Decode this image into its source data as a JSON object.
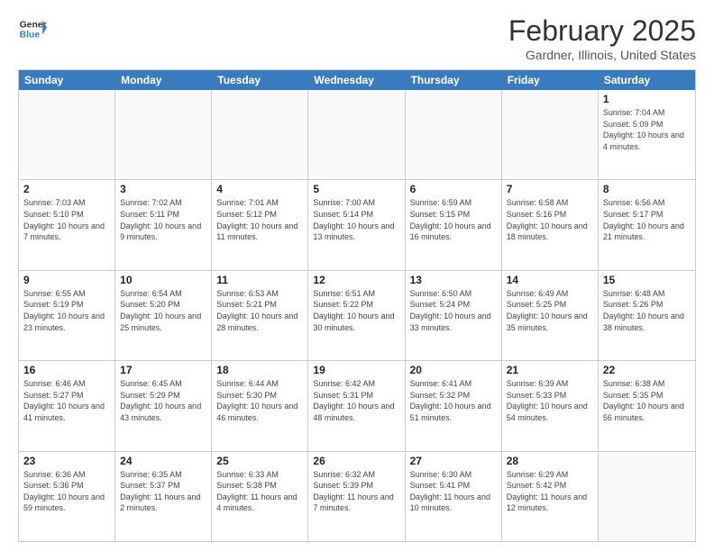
{
  "logo": {
    "line1": "General",
    "line2": "Blue"
  },
  "title": "February 2025",
  "subtitle": "Gardner, Illinois, United States",
  "days_of_week": [
    "Sunday",
    "Monday",
    "Tuesday",
    "Wednesday",
    "Thursday",
    "Friday",
    "Saturday"
  ],
  "weeks": [
    [
      {
        "day": "",
        "info": ""
      },
      {
        "day": "",
        "info": ""
      },
      {
        "day": "",
        "info": ""
      },
      {
        "day": "",
        "info": ""
      },
      {
        "day": "",
        "info": ""
      },
      {
        "day": "",
        "info": ""
      },
      {
        "day": "1",
        "info": "Sunrise: 7:04 AM\nSunset: 5:09 PM\nDaylight: 10 hours and 4 minutes."
      }
    ],
    [
      {
        "day": "2",
        "info": "Sunrise: 7:03 AM\nSunset: 5:10 PM\nDaylight: 10 hours and 7 minutes."
      },
      {
        "day": "3",
        "info": "Sunrise: 7:02 AM\nSunset: 5:11 PM\nDaylight: 10 hours and 9 minutes."
      },
      {
        "day": "4",
        "info": "Sunrise: 7:01 AM\nSunset: 5:12 PM\nDaylight: 10 hours and 11 minutes."
      },
      {
        "day": "5",
        "info": "Sunrise: 7:00 AM\nSunset: 5:14 PM\nDaylight: 10 hours and 13 minutes."
      },
      {
        "day": "6",
        "info": "Sunrise: 6:59 AM\nSunset: 5:15 PM\nDaylight: 10 hours and 16 minutes."
      },
      {
        "day": "7",
        "info": "Sunrise: 6:58 AM\nSunset: 5:16 PM\nDaylight: 10 hours and 18 minutes."
      },
      {
        "day": "8",
        "info": "Sunrise: 6:56 AM\nSunset: 5:17 PM\nDaylight: 10 hours and 21 minutes."
      }
    ],
    [
      {
        "day": "9",
        "info": "Sunrise: 6:55 AM\nSunset: 5:19 PM\nDaylight: 10 hours and 23 minutes."
      },
      {
        "day": "10",
        "info": "Sunrise: 6:54 AM\nSunset: 5:20 PM\nDaylight: 10 hours and 25 minutes."
      },
      {
        "day": "11",
        "info": "Sunrise: 6:53 AM\nSunset: 5:21 PM\nDaylight: 10 hours and 28 minutes."
      },
      {
        "day": "12",
        "info": "Sunrise: 6:51 AM\nSunset: 5:22 PM\nDaylight: 10 hours and 30 minutes."
      },
      {
        "day": "13",
        "info": "Sunrise: 6:50 AM\nSunset: 5:24 PM\nDaylight: 10 hours and 33 minutes."
      },
      {
        "day": "14",
        "info": "Sunrise: 6:49 AM\nSunset: 5:25 PM\nDaylight: 10 hours and 35 minutes."
      },
      {
        "day": "15",
        "info": "Sunrise: 6:48 AM\nSunset: 5:26 PM\nDaylight: 10 hours and 38 minutes."
      }
    ],
    [
      {
        "day": "16",
        "info": "Sunrise: 6:46 AM\nSunset: 5:27 PM\nDaylight: 10 hours and 41 minutes."
      },
      {
        "day": "17",
        "info": "Sunrise: 6:45 AM\nSunset: 5:29 PM\nDaylight: 10 hours and 43 minutes."
      },
      {
        "day": "18",
        "info": "Sunrise: 6:44 AM\nSunset: 5:30 PM\nDaylight: 10 hours and 46 minutes."
      },
      {
        "day": "19",
        "info": "Sunrise: 6:42 AM\nSunset: 5:31 PM\nDaylight: 10 hours and 48 minutes."
      },
      {
        "day": "20",
        "info": "Sunrise: 6:41 AM\nSunset: 5:32 PM\nDaylight: 10 hours and 51 minutes."
      },
      {
        "day": "21",
        "info": "Sunrise: 6:39 AM\nSunset: 5:33 PM\nDaylight: 10 hours and 54 minutes."
      },
      {
        "day": "22",
        "info": "Sunrise: 6:38 AM\nSunset: 5:35 PM\nDaylight: 10 hours and 56 minutes."
      }
    ],
    [
      {
        "day": "23",
        "info": "Sunrise: 6:36 AM\nSunset: 5:36 PM\nDaylight: 10 hours and 59 minutes."
      },
      {
        "day": "24",
        "info": "Sunrise: 6:35 AM\nSunset: 5:37 PM\nDaylight: 11 hours and 2 minutes."
      },
      {
        "day": "25",
        "info": "Sunrise: 6:33 AM\nSunset: 5:38 PM\nDaylight: 11 hours and 4 minutes."
      },
      {
        "day": "26",
        "info": "Sunrise: 6:32 AM\nSunset: 5:39 PM\nDaylight: 11 hours and 7 minutes."
      },
      {
        "day": "27",
        "info": "Sunrise: 6:30 AM\nSunset: 5:41 PM\nDaylight: 11 hours and 10 minutes."
      },
      {
        "day": "28",
        "info": "Sunrise: 6:29 AM\nSunset: 5:42 PM\nDaylight: 11 hours and 12 minutes."
      },
      {
        "day": "",
        "info": ""
      }
    ]
  ]
}
